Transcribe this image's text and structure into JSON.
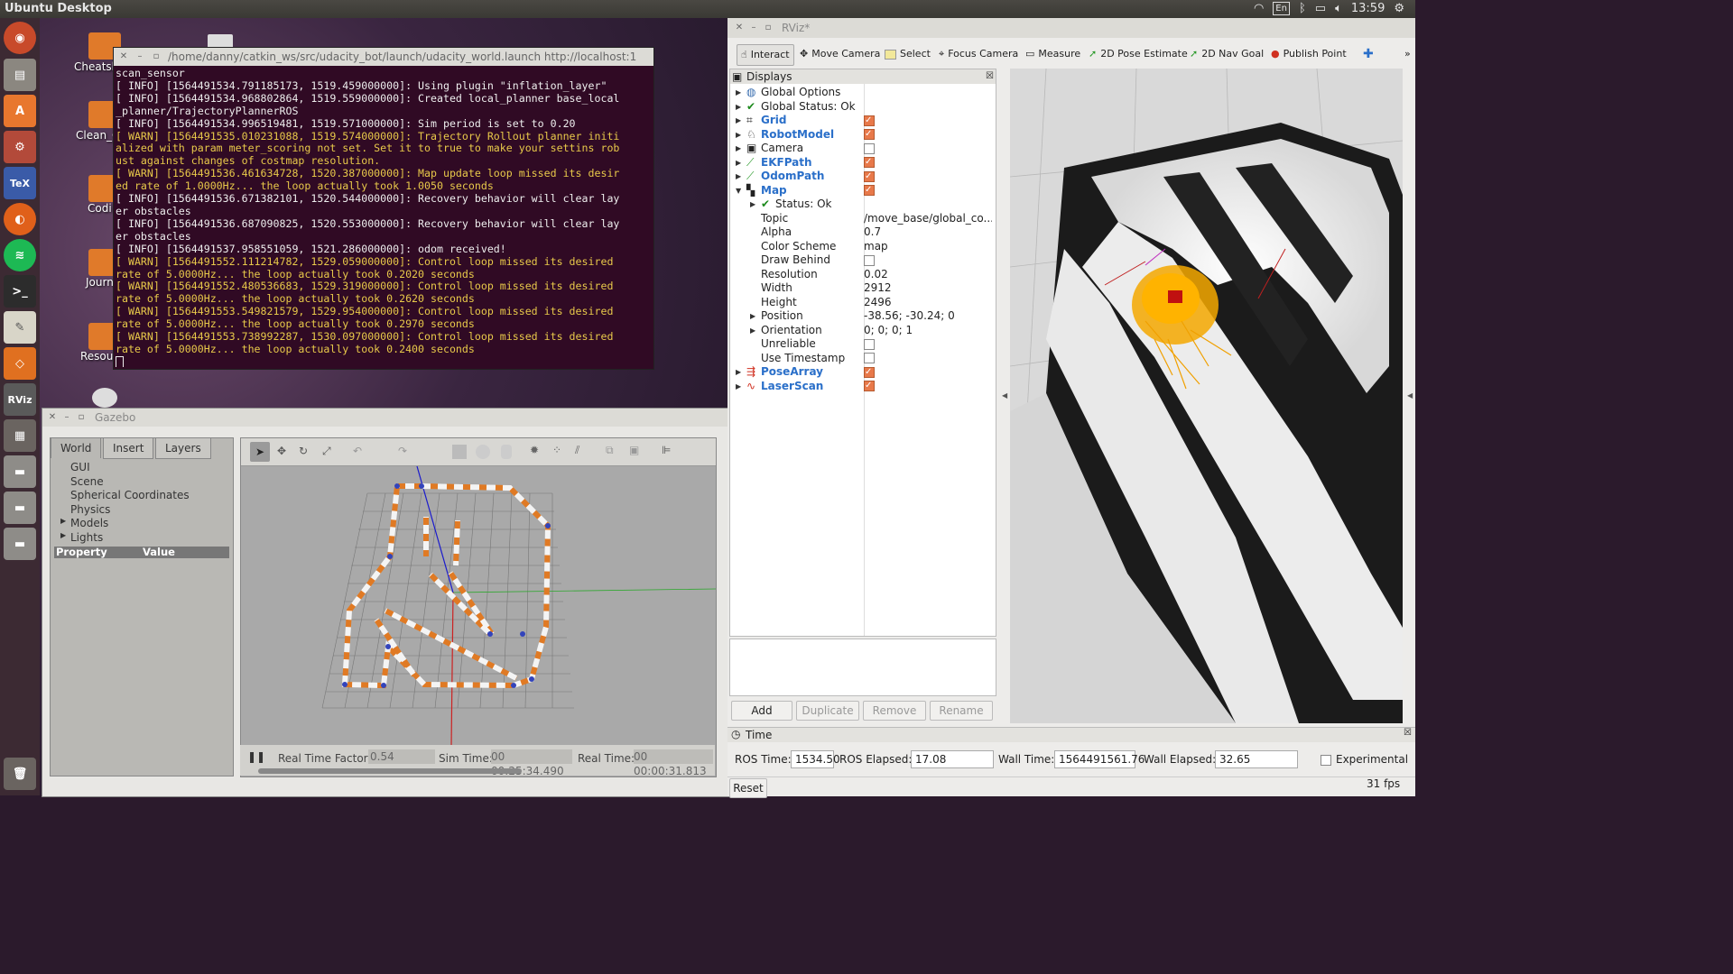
{
  "topbar": {
    "title": "Ubuntu Desktop",
    "keyboard": "En",
    "time": "13:59"
  },
  "launcher": {
    "items": [
      "Dash",
      "Files",
      "Software Center",
      "System Settings",
      "TeXstudio",
      "Firefox",
      "Spotify",
      "Terminal",
      "Text Editor",
      "Sublime Text",
      "RViz",
      "Workspace",
      "Drive",
      "Drive",
      "Drive",
      "Trash"
    ],
    "rviz_text": "RViz",
    "tex_text": "TeX"
  },
  "desktop": {
    "icons": [
      {
        "label": "Cheatsh"
      },
      {
        "label": "Clean_C"
      },
      {
        "label": "Codi"
      },
      {
        "label": "Journ"
      },
      {
        "label": "Resou"
      }
    ]
  },
  "terminal": {
    "title": "/home/danny/catkin_ws/src/udacity_bot/launch/udacity_world.launch http://localhost:1",
    "lines": [
      {
        "t": "scan_sensor",
        "w": false
      },
      {
        "t": "[ INFO] [1564491534.791185173, 1519.459000000]: Using plugin \"inflation_layer\"",
        "w": false
      },
      {
        "t": "[ INFO] [1564491534.968802864, 1519.559000000]: Created local_planner base_local",
        "w": false
      },
      {
        "t": "_planner/TrajectoryPlannerROS",
        "w": false
      },
      {
        "t": "[ INFO] [1564491534.996519481, 1519.571000000]: Sim period is set to 0.20",
        "w": false
      },
      {
        "t": "[ WARN] [1564491535.010231088, 1519.574000000]: Trajectory Rollout planner initi",
        "w": true
      },
      {
        "t": "alized with param meter_scoring not set. Set it to true to make your settins rob",
        "w": true
      },
      {
        "t": "ust against changes of costmap resolution.",
        "w": true
      },
      {
        "t": "[ WARN] [1564491536.461634728, 1520.387000000]: Map update loop missed its desir",
        "w": true
      },
      {
        "t": "ed rate of 1.0000Hz... the loop actually took 1.0050 seconds",
        "w": true
      },
      {
        "t": "[ INFO] [1564491536.671382101, 1520.544000000]: Recovery behavior will clear lay",
        "w": false
      },
      {
        "t": "er obstacles",
        "w": false
      },
      {
        "t": "[ INFO] [1564491536.687090825, 1520.553000000]: Recovery behavior will clear lay",
        "w": false
      },
      {
        "t": "er obstacles",
        "w": false
      },
      {
        "t": "[ INFO] [1564491537.958551059, 1521.286000000]: odom received!",
        "w": false
      },
      {
        "t": "[ WARN] [1564491552.111214782, 1529.059000000]: Control loop missed its desired",
        "w": true
      },
      {
        "t": "rate of 5.0000Hz... the loop actually took 0.2020 seconds",
        "w": true
      },
      {
        "t": "[ WARN] [1564491552.480536683, 1529.319000000]: Control loop missed its desired",
        "w": true
      },
      {
        "t": "rate of 5.0000Hz... the loop actually took 0.2620 seconds",
        "w": true
      },
      {
        "t": "[ WARN] [1564491553.549821579, 1529.954000000]: Control loop missed its desired",
        "w": true
      },
      {
        "t": "rate of 5.0000Hz... the loop actually took 0.2970 seconds",
        "w": true
      },
      {
        "t": "[ WARN] [1564491553.738992287, 1530.097000000]: Control loop missed its desired",
        "w": true
      },
      {
        "t": "rate of 5.0000Hz... the loop actually took 0.2400 seconds",
        "w": true
      }
    ]
  },
  "gazebo": {
    "title": "Gazebo",
    "tabs": [
      "World",
      "Insert",
      "Layers"
    ],
    "tree": [
      "GUI",
      "Scene",
      "Spherical Coordinates",
      "Physics",
      "Models",
      "Lights"
    ],
    "prop_header": "Property",
    "value_header": "Value",
    "rtf_label": "Real Time Factor:",
    "rtf": "0.54",
    "sim_label": "Sim Time:",
    "sim": "00 00:25:34.490",
    "real_label": "Real Time:",
    "real": "00 00:00:31.813"
  },
  "rviz": {
    "title": "RViz*",
    "tools": [
      "Interact",
      "Move Camera",
      "Select",
      "Focus Camera",
      "Measure",
      "2D Pose Estimate",
      "2D Nav Goal",
      "Publish Point"
    ],
    "displays_title": "Displays",
    "rows": {
      "global_options": "Global Options",
      "global_status": "Global Status: Ok",
      "grid": "Grid",
      "robot_model": "RobotModel",
      "camera": "Camera",
      "ekf": "EKFPath",
      "odom": "OdomPath",
      "map": "Map",
      "status": "Status: Ok",
      "topic_l": "Topic",
      "topic_v": "/move_base/global_co...",
      "alpha_l": "Alpha",
      "alpha_v": "0.7",
      "scheme_l": "Color Scheme",
      "scheme_v": "map",
      "draw_l": "Draw Behind",
      "res_l": "Resolution",
      "res_v": "0.02",
      "width_l": "Width",
      "width_v": "2912",
      "height_l": "Height",
      "height_v": "2496",
      "pos_l": "Position",
      "pos_v": "-38.56; -30.24; 0",
      "ori_l": "Orientation",
      "ori_v": "0; 0; 0; 1",
      "unrel_l": "Unreliable",
      "ts_l": "Use Timestamp",
      "pose": "PoseArray",
      "laser": "LaserScan"
    },
    "buttons": [
      "Add",
      "Duplicate",
      "Remove",
      "Rename"
    ],
    "time": {
      "title": "Time",
      "ros_time_l": "ROS Time:",
      "ros_time": "1534.50",
      "ros_el_l": "ROS Elapsed:",
      "ros_el": "17.08",
      "wall_l": "Wall Time:",
      "wall": "1564491561.76",
      "wall_el_l": "Wall Elapsed:",
      "wall_el": "32.65",
      "exp": "Experimental",
      "reset": "Reset",
      "fps": "31 fps"
    }
  }
}
